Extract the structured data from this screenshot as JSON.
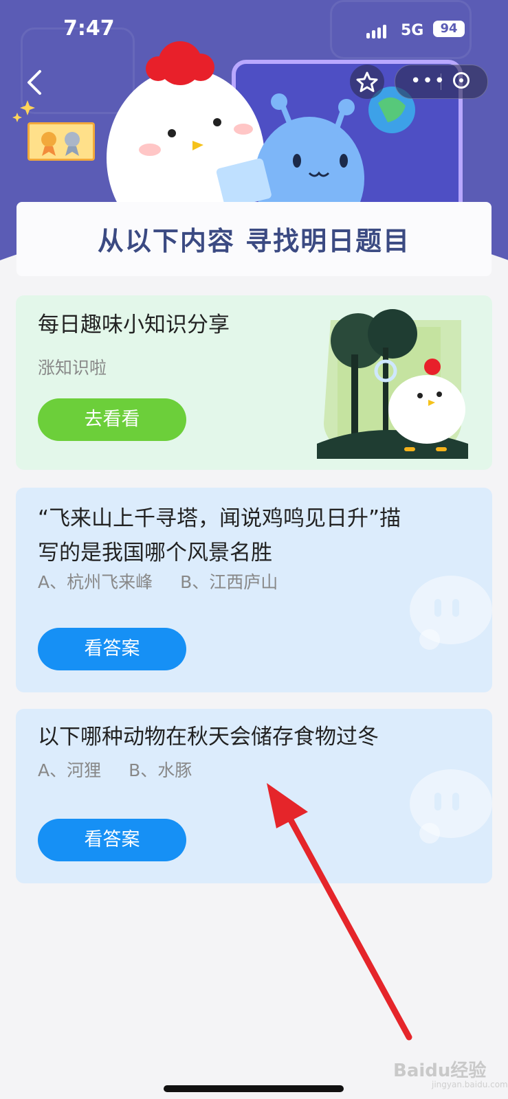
{
  "status_bar": {
    "time": "7:47",
    "network": "5G",
    "battery": "94"
  },
  "banner": {
    "title": "从以下内容 寻找明日题目"
  },
  "cards": [
    {
      "title": "每日趣味小知识分享",
      "subtitle": "涨知识啦",
      "button": "去看看"
    },
    {
      "title_line1": "“飞来山上千寻塔，闻说鸡鸣见日升”描",
      "title_line2": "写的是我国哪个风景名胜",
      "option_a": "A、杭州飞来峰",
      "option_b": "B、江西庐山",
      "button": "看答案"
    },
    {
      "title": "以下哪种动物在秋天会储存食物过冬",
      "option_a": "A、河狸",
      "option_b": "B、水豚",
      "button": "看答案"
    }
  ],
  "watermark": {
    "text": "Baidu经验",
    "sub": "jingyan.baidu.com"
  },
  "colors": {
    "header": "#5b5cb5",
    "green_button": "#6ccf3a",
    "blue_button": "#1690f5",
    "arrow": "#e5252a"
  }
}
